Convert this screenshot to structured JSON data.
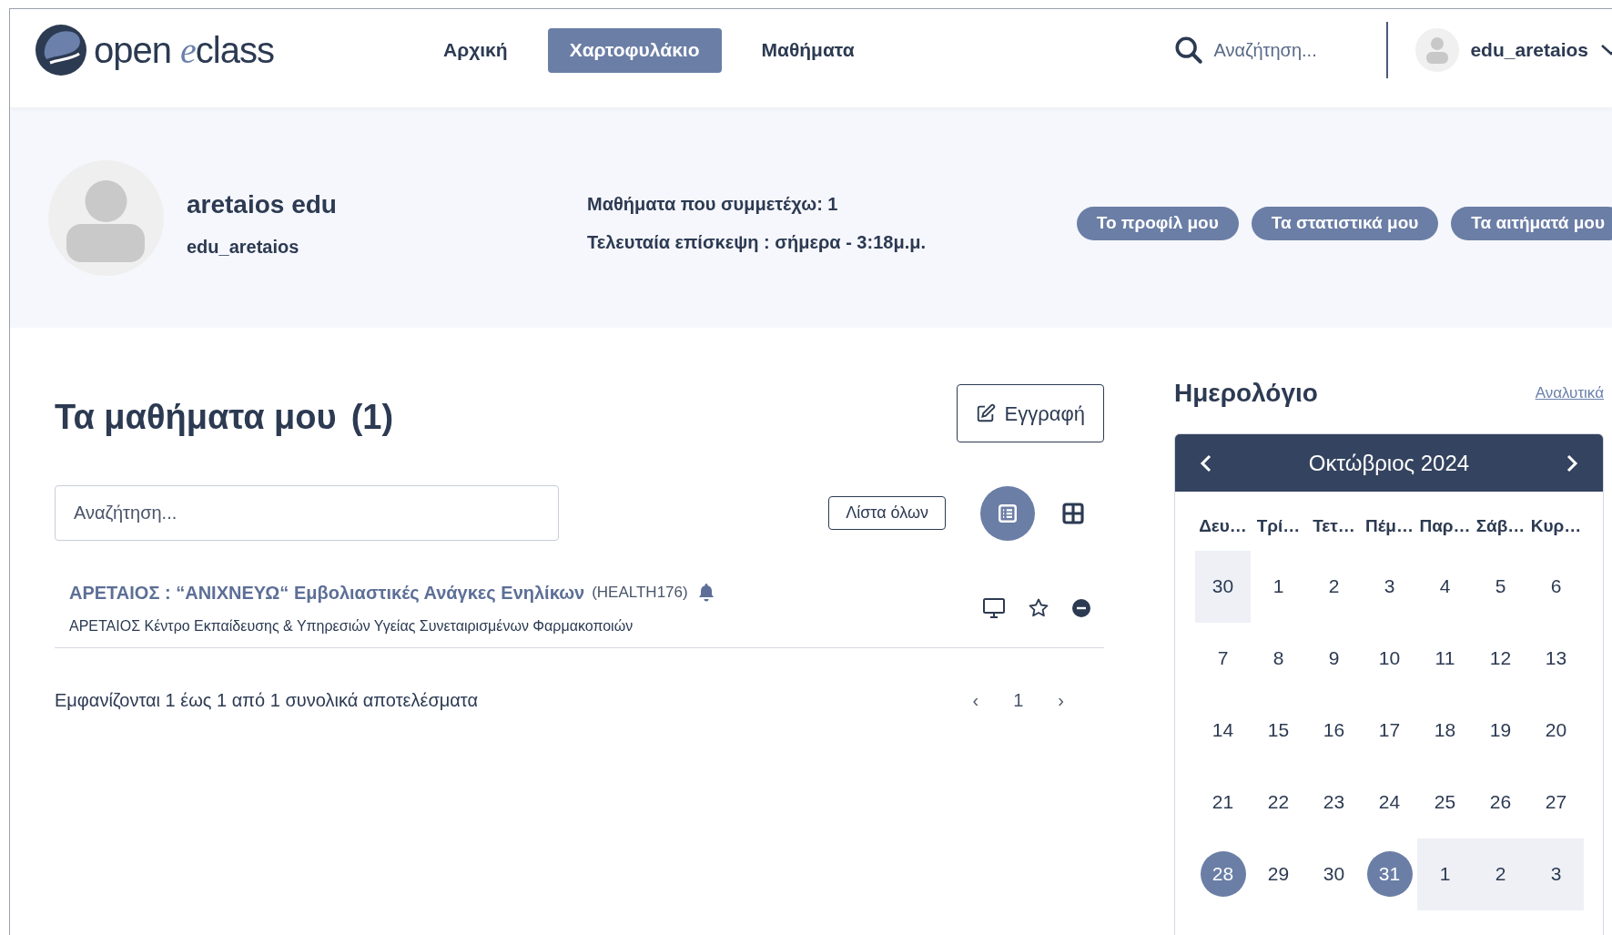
{
  "header": {
    "logo": {
      "text": "open",
      "accent": "e",
      "rest": "class"
    },
    "nav": [
      {
        "label": "Αρχική",
        "selected": false
      },
      {
        "label": "Χαρτοφυλάκιο",
        "selected": true
      },
      {
        "label": "Μαθήματα",
        "selected": false
      }
    ],
    "search": {
      "placeholder": "Αναζήτηση..."
    },
    "user": {
      "username": "edu_aretaios"
    }
  },
  "profile": {
    "name": "aretaios edu",
    "username": "edu_aretaios",
    "stats": [
      "Μαθήματα που συμμετέχω: 1",
      "Τελευταία επίσκεψη : σήμερα - 3:18μ.μ."
    ],
    "buttons": [
      "Το προφίλ μου",
      "Τα στατιστικά μου",
      "Τα αιτήματά μου"
    ]
  },
  "courses": {
    "title": "Τα μαθήματα μου",
    "count": "(1)",
    "register_button": "Εγγραφή",
    "search": {
      "placeholder": "Αναζήτηση..."
    },
    "list_all_button": "Λίστα όλων",
    "views": [
      {
        "kind": "list",
        "selected": true
      },
      {
        "kind": "grid",
        "selected": false
      }
    ],
    "items": [
      {
        "title": "ΑΡΕΤΑΙΟΣ : “ΑΝΙΧΝΕΥΩ“ Εμβολιαστικές Ανάγκες Ενηλίκων",
        "code": "(HEALTH176)",
        "notifications": true,
        "subtitle": "ΑΡΕΤΑΙΟΣ Κέντρο Εκπαίδευσης & Υπηρεσιών Υγείας Συνεταιρισμένων Φαρμακοποιών"
      }
    ],
    "summary": "Εμφανίζονται 1 έως 1 από 1 συνολικά αποτελέσματα",
    "pagination": {
      "prev": "‹",
      "pages": [
        "1"
      ],
      "next": "›"
    }
  },
  "calendar": {
    "title": "Ημερολόγιο",
    "details_link": "Αναλυτικά",
    "month": "Οκτώβριος 2024",
    "weekdays": [
      "Δευ…",
      "Τρί…",
      "Τετ…",
      "Πέμ…",
      "Παρ…",
      "Σάβ…",
      "Κυρ…"
    ],
    "weeks": [
      [
        {
          "day": "30",
          "outside": true,
          "marked": false
        },
        {
          "day": "1",
          "outside": false,
          "marked": false
        },
        {
          "day": "2",
          "outside": false,
          "marked": false
        },
        {
          "day": "3",
          "outside": false,
          "marked": false
        },
        {
          "day": "4",
          "outside": false,
          "marked": false
        },
        {
          "day": "5",
          "outside": false,
          "marked": false
        },
        {
          "day": "6",
          "outside": false,
          "marked": false
        }
      ],
      [
        {
          "day": "7",
          "outside": false,
          "marked": false
        },
        {
          "day": "8",
          "outside": false,
          "marked": false
        },
        {
          "day": "9",
          "outside": false,
          "marked": false
        },
        {
          "day": "10",
          "outside": false,
          "marked": false
        },
        {
          "day": "11",
          "outside": false,
          "marked": false
        },
        {
          "day": "12",
          "outside": false,
          "marked": false
        },
        {
          "day": "13",
          "outside": false,
          "marked": false
        }
      ],
      [
        {
          "day": "14",
          "outside": false,
          "marked": false
        },
        {
          "day": "15",
          "outside": false,
          "marked": false
        },
        {
          "day": "16",
          "outside": false,
          "marked": false
        },
        {
          "day": "17",
          "outside": false,
          "marked": false
        },
        {
          "day": "18",
          "outside": false,
          "marked": false
        },
        {
          "day": "19",
          "outside": false,
          "marked": false
        },
        {
          "day": "20",
          "outside": false,
          "marked": false
        }
      ],
      [
        {
          "day": "21",
          "outside": false,
          "marked": false
        },
        {
          "day": "22",
          "outside": false,
          "marked": false
        },
        {
          "day": "23",
          "outside": false,
          "marked": false
        },
        {
          "day": "24",
          "outside": false,
          "marked": false
        },
        {
          "day": "25",
          "outside": false,
          "marked": false
        },
        {
          "day": "26",
          "outside": false,
          "marked": false
        },
        {
          "day": "27",
          "outside": false,
          "marked": false
        }
      ],
      [
        {
          "day": "28",
          "outside": false,
          "marked": true
        },
        {
          "day": "29",
          "outside": false,
          "marked": false
        },
        {
          "day": "30",
          "outside": false,
          "marked": false
        },
        {
          "day": "31",
          "outside": false,
          "marked": true
        },
        {
          "day": "1",
          "outside": true,
          "marked": false
        },
        {
          "day": "2",
          "outside": true,
          "marked": false
        },
        {
          "day": "3",
          "outside": true,
          "marked": false
        }
      ]
    ]
  }
}
